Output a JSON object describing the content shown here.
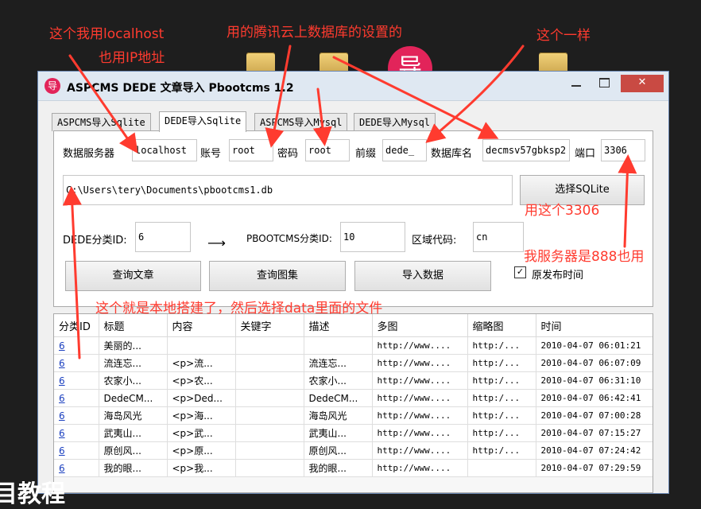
{
  "window": {
    "title": "ASPCMS DEDE 文章导入 Pbootcms 1.2",
    "icon_char": "导",
    "min_icon": "minimize-icon",
    "max_icon": "maximize-icon",
    "close_icon": "close-icon",
    "close_glyph": "✕"
  },
  "desktop": {
    "app_char": "导"
  },
  "tabs": [
    {
      "label": "ASPCMS导入Sqlite"
    },
    {
      "label": "DEDE导入Sqlite"
    },
    {
      "label": "ASPCMS导入Mysql"
    },
    {
      "label": "DEDE导入Mysql"
    }
  ],
  "form": {
    "server_label": "数据服务器",
    "server_value": "localhost",
    "account_label": "账号",
    "account_value": "root",
    "password_label": "密码",
    "password_value": "root",
    "prefix_label": "前缀",
    "prefix_value": "dede_",
    "dbname_label": "数据库名",
    "dbname_value": "decmsv57gbksp2",
    "port_label": "端口",
    "port_value": "3306",
    "file_path": "C:\\Users\\tery\\Documents\\pbootcms1.db",
    "select_sqlite_label": "选择SQLite",
    "dede_category_label": "DEDE分类ID:",
    "dede_category_value": "6",
    "arrow_glyph": "⟶",
    "pboot_category_label": "PBOOTCMS分类ID:",
    "pboot_category_value": "10",
    "region_label": "区域代码:",
    "region_value": "cn",
    "query_articles_label": "查询文章",
    "query_gallery_label": "查询图集",
    "import_label": "导入数据",
    "original_time_label": "原发布时间",
    "original_time_checked": "✓"
  },
  "table": {
    "headers": [
      "分类ID",
      "标题",
      "内容",
      "关键字",
      "描述",
      "多图",
      "缩略图",
      "时间"
    ],
    "rows": [
      [
        "6",
        "美丽的...",
        "",
        "",
        "",
        "http://www....",
        "http:/...",
        "2010-04-07 06:01:21"
      ],
      [
        "6",
        "流连忘...",
        "<p>流...",
        "",
        "流连忘...",
        "http://www....",
        "http:/...",
        "2010-04-07 06:07:09"
      ],
      [
        "6",
        "农家小...",
        "<p>农...",
        "",
        "农家小...",
        "http://www....",
        "http:/...",
        "2010-04-07 06:31:10"
      ],
      [
        "6",
        "DedeCM...",
        "<p>Ded...",
        "",
        "DedeCM...",
        "http://www....",
        "http:/...",
        "2010-04-07 06:42:41"
      ],
      [
        "6",
        "海岛风光",
        "<p>海...",
        "",
        "海岛风光",
        "http://www....",
        "http:/...",
        "2010-04-07 07:00:28"
      ],
      [
        "6",
        "武夷山...",
        "<p>武...",
        "",
        "武夷山...",
        "http://www....",
        "http:/...",
        "2010-04-07 07:15:27"
      ],
      [
        "6",
        "原创风...",
        "<p>原...",
        "",
        "原创风...",
        "http://www....",
        "http:/...",
        "2010-04-07 07:24:42"
      ],
      [
        "6",
        "我的眼...",
        "<p>我...",
        "",
        "我的眼...",
        "http://www....",
        "",
        "2010-04-07 07:29:59"
      ]
    ]
  },
  "annotations": {
    "localhost_note": "这个我用localhost",
    "ip_note": "也用IP地址",
    "cloud_note": "用的腾讯云上数据库的设置的",
    "same_note": "这个一样",
    "port_note": "用这个3306",
    "server_port_note": "我服务器是888也用",
    "local_note": "这个就是本地搭建了，然后选择data里面的文件",
    "annotation_color": "#ff3b2f"
  },
  "overlay": {
    "bottom_text": "目教程"
  }
}
